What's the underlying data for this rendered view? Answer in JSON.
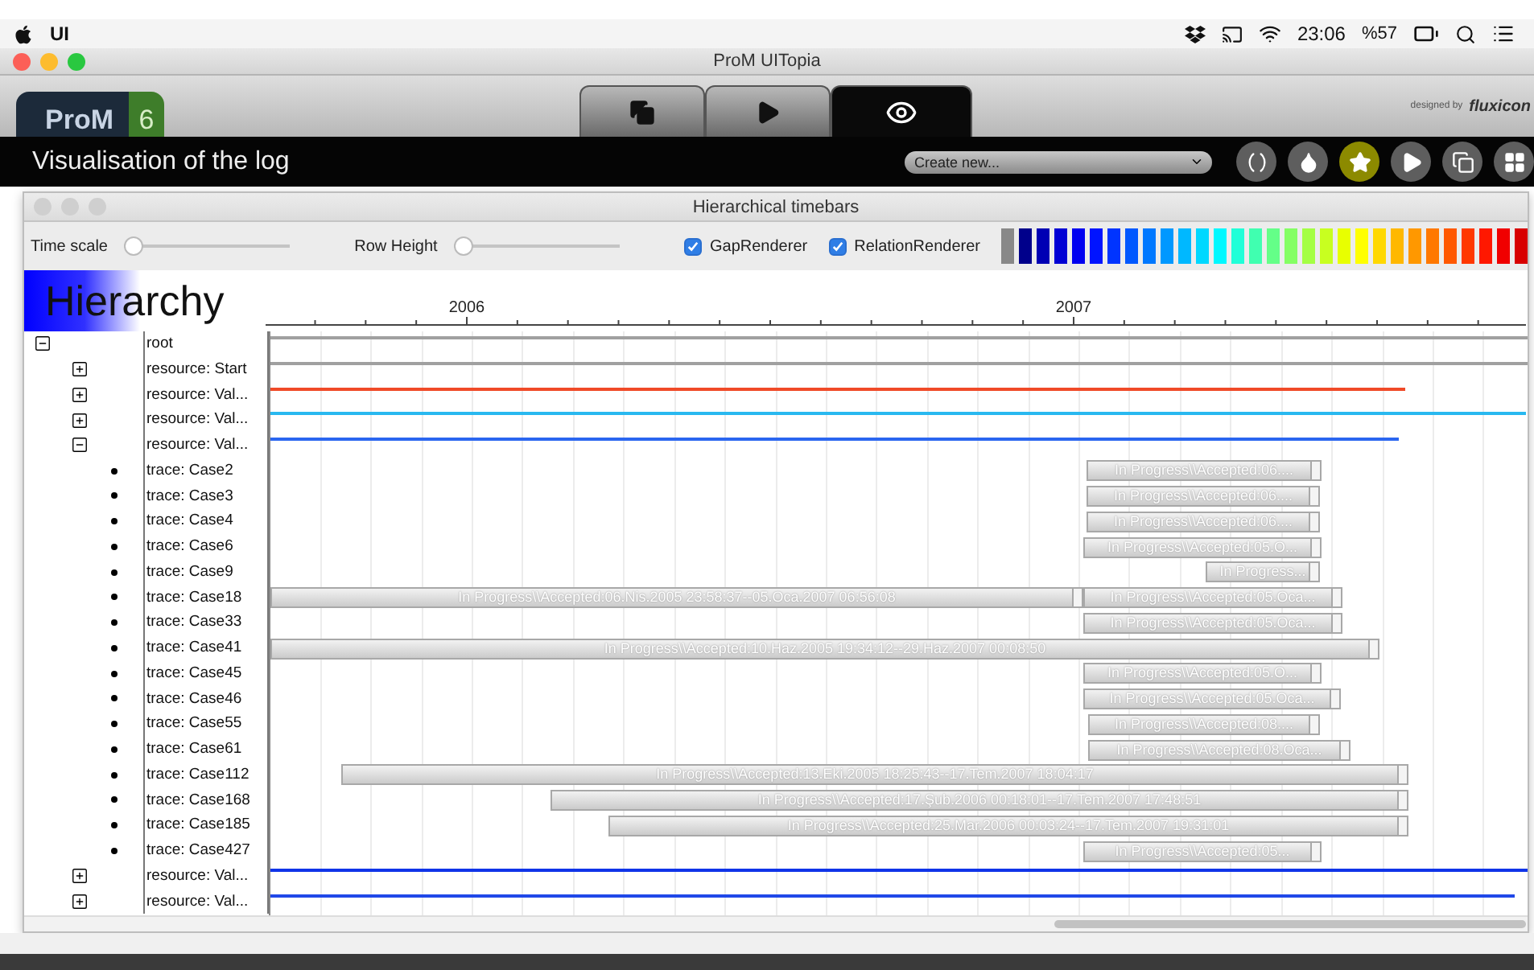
{
  "menubar": {
    "app": "UI",
    "clock": "23:06",
    "battery": "%57"
  },
  "window": {
    "title": "ProM UITopia"
  },
  "header": {
    "logo": "ProM",
    "version": "6",
    "designed_by": "designed by",
    "brand": "fluxicon",
    "tabs": [
      {
        "kind": "copy",
        "selected": false
      },
      {
        "kind": "play",
        "selected": false
      },
      {
        "kind": "eye",
        "selected": true
      }
    ]
  },
  "action_bar": {
    "title": "Visualisation of the log",
    "dropdown": {
      "value": "Create new..."
    },
    "tools": [
      {
        "kind": "parens",
        "selected": false
      },
      {
        "kind": "drop",
        "selected": false
      },
      {
        "kind": "star",
        "selected": true
      },
      {
        "kind": "play",
        "selected": false
      },
      {
        "kind": "copy",
        "selected": false
      },
      {
        "kind": "grid",
        "selected": false
      }
    ]
  },
  "panel": {
    "title": "Hierarchical timebars",
    "sliders": [
      {
        "label": "Time scale",
        "level": 0
      },
      {
        "label": "Row Height",
        "level": 0
      }
    ],
    "checkboxes": [
      {
        "label": "GapRenderer",
        "checked": true
      },
      {
        "label": "RelationRenderer",
        "checked": true
      }
    ],
    "palette": [
      {
        "color": "#888888"
      },
      {
        "color": "#00008b"
      },
      {
        "color": "#0000b4"
      },
      {
        "color": "#0000d4"
      },
      {
        "color": "#0000f0"
      },
      {
        "color": "#0014ff"
      },
      {
        "color": "#0034ff"
      },
      {
        "color": "#0058ff"
      },
      {
        "color": "#0078ff"
      },
      {
        "color": "#0098ff"
      },
      {
        "color": "#00b8ff"
      },
      {
        "color": "#00d8ff"
      },
      {
        "color": "#00f8ff"
      },
      {
        "color": "#20ffd8"
      },
      {
        "color": "#40ffb0"
      },
      {
        "color": "#64ff88"
      },
      {
        "color": "#84ff64"
      },
      {
        "color": "#a4ff44"
      },
      {
        "color": "#c8ff20"
      },
      {
        "color": "#e8ff00"
      },
      {
        "color": "#ffff00"
      },
      {
        "color": "#ffd800"
      },
      {
        "color": "#ffb800"
      },
      {
        "color": "#ff9800"
      },
      {
        "color": "#ff7800"
      },
      {
        "color": "#ff5800"
      },
      {
        "color": "#ff3800"
      },
      {
        "color": "#ff1800"
      },
      {
        "color": "#f00000"
      },
      {
        "color": "#d80000"
      }
    ],
    "hierarchy_title": "Hierarchy",
    "axis": [
      "2006",
      "2007"
    ],
    "tree": {
      "kind": "group",
      "label": "root",
      "expanded": true,
      "color": "#a0a0a0",
      "children": [
        {
          "kind": "group",
          "label": "resource: Start",
          "expanded": false,
          "color": "#a0a0a0"
        },
        {
          "kind": "group",
          "label": "resource: Val...",
          "expanded": false,
          "color": "#f04a28"
        },
        {
          "kind": "group",
          "label": "resource: Val...",
          "expanded": false,
          "color": "#28b8f0"
        },
        {
          "kind": "group",
          "label": "resource: Val...",
          "expanded": true,
          "color": "#2a66f0",
          "children": [
            {
              "kind": "trace",
              "label": "trace: Case2",
              "bars": [
                "In Progress\\\\Accepted:06...."
              ]
            },
            {
              "kind": "trace",
              "label": "trace: Case3",
              "bars": [
                "In Progress\\\\Accepted:06...."
              ]
            },
            {
              "kind": "trace",
              "label": "trace: Case4",
              "bars": [
                "In Progress\\\\Accepted:06...."
              ]
            },
            {
              "kind": "trace",
              "label": "trace: Case6",
              "bars": [
                "In Progress\\\\Accepted:05.O..."
              ]
            },
            {
              "kind": "trace",
              "label": "trace: Case9",
              "bars": [
                "In Progress..."
              ]
            },
            {
              "kind": "trace",
              "label": "trace: Case18",
              "bars": [
                "In Progress\\\\Accepted:06.Nis.2005 23:58:37--05.Oca.2007 06:56:08",
                "In Progress\\\\Accepted:05.Oca..."
              ]
            },
            {
              "kind": "trace",
              "label": "trace: Case33",
              "bars": [
                "In Progress\\\\Accepted:05.Oca..."
              ]
            },
            {
              "kind": "trace",
              "label": "trace: Case41",
              "bars": [
                "In Progress\\\\Accepted:10.Haz.2005 19:34:12--29.Haz.2007 00:08:50"
              ]
            },
            {
              "kind": "trace",
              "label": "trace: Case45",
              "bars": [
                "In Progress\\\\Accepted:05.O..."
              ]
            },
            {
              "kind": "trace",
              "label": "trace: Case46",
              "bars": [
                "In Progress\\\\Accepted:05.Oca..."
              ]
            },
            {
              "kind": "trace",
              "label": "trace: Case55",
              "bars": [
                "In Progress\\\\Accepted:08...."
              ]
            },
            {
              "kind": "trace",
              "label": "trace: Case61",
              "bars": [
                "In Progress\\\\Accepted:08.Oca..."
              ]
            },
            {
              "kind": "trace",
              "label": "trace: Case112",
              "bars": [
                "In Progress\\\\Accepted:13.Eki.2005 18:25:43--17.Tem.2007 18:04:17"
              ]
            },
            {
              "kind": "trace",
              "label": "trace: Case168",
              "bars": [
                "In Progress\\\\Accepted:17.Şub.2006 00:18:01--17.Tem.2007 17:48:51"
              ]
            },
            {
              "kind": "trace",
              "label": "trace: Case185",
              "bars": [
                "In Progress\\\\Accepted:25.Mar.2006 00:03:24--17.Tem.2007 19:31:01"
              ]
            },
            {
              "kind": "trace",
              "label": "trace: Case427",
              "bars": [
                "In Progress\\\\Accepted:05..."
              ]
            }
          ]
        },
        {
          "kind": "group",
          "label": "resource: Val...",
          "expanded": false,
          "color": "#1034e8"
        },
        {
          "kind": "group",
          "label": "resource: Val...",
          "expanded": false,
          "color": "#2048e8"
        }
      ]
    }
  }
}
